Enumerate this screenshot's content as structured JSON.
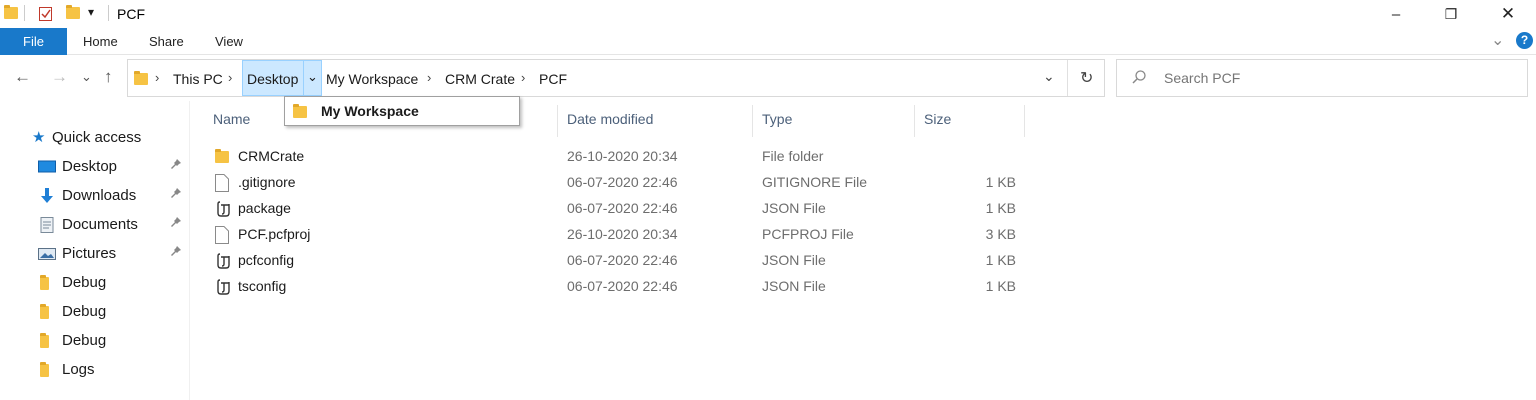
{
  "window": {
    "title": "PCF",
    "minimize_label": "–",
    "maximize_label": "❐",
    "close_label": "✕"
  },
  "quick_access_toolbar": {
    "dropdown_label": "▾"
  },
  "ribbon": {
    "tabs": [
      {
        "label": "File"
      },
      {
        "label": "Home"
      },
      {
        "label": "Share"
      },
      {
        "label": "View"
      }
    ],
    "expand_label": "⌄",
    "help_label": "?"
  },
  "address": {
    "crumbs": [
      "This PC",
      "Desktop",
      "My Workspace",
      "CRM Crate",
      "PCF"
    ],
    "separator": "›",
    "dropdown_chevron": "⌄",
    "history_chevron": "⌄",
    "refresh_label": "↻"
  },
  "crumb_dropdown": {
    "items": [
      {
        "label": "My Workspace"
      }
    ]
  },
  "search": {
    "placeholder": "Search PCF"
  },
  "nav_buttons": {
    "back": "←",
    "forward": "→",
    "recent": "⌄",
    "up": "↑"
  },
  "sidebar": {
    "quick_access_label": "Quick access",
    "items": [
      {
        "label": "Desktop",
        "icon": "desktop-icon",
        "pinned": true
      },
      {
        "label": "Downloads",
        "icon": "download-icon",
        "pinned": true
      },
      {
        "label": "Documents",
        "icon": "documents-icon",
        "pinned": true
      },
      {
        "label": "Pictures",
        "icon": "pictures-icon",
        "pinned": true
      },
      {
        "label": "Debug",
        "icon": "folder-icon",
        "pinned": false
      },
      {
        "label": "Debug",
        "icon": "folder-icon",
        "pinned": false
      },
      {
        "label": "Debug",
        "icon": "folder-icon",
        "pinned": false
      },
      {
        "label": "Logs",
        "icon": "folder-icon",
        "pinned": false
      }
    ],
    "pin_glyph": "📌"
  },
  "files": {
    "columns": [
      {
        "label": "Name"
      },
      {
        "label": "Date modified"
      },
      {
        "label": "Type"
      },
      {
        "label": "Size"
      }
    ],
    "rows": [
      {
        "name": "CRMCrate",
        "date": "26-10-2020 20:34",
        "type": "File folder",
        "size": "",
        "icon": "folder-icon"
      },
      {
        "name": ".gitignore",
        "date": "06-07-2020 22:46",
        "type": "GITIGNORE File",
        "size": "1 KB",
        "icon": "file-icon"
      },
      {
        "name": "package",
        "date": "06-07-2020 22:46",
        "type": "JSON File",
        "size": "1 KB",
        "icon": "json-file-icon"
      },
      {
        "name": "PCF.pcfproj",
        "date": "26-10-2020 20:34",
        "type": "PCFPROJ File",
        "size": "3 KB",
        "icon": "file-icon"
      },
      {
        "name": "pcfconfig",
        "date": "06-07-2020 22:46",
        "type": "JSON File",
        "size": "1 KB",
        "icon": "json-file-icon"
      },
      {
        "name": "tsconfig",
        "date": "06-07-2020 22:46",
        "type": "JSON File",
        "size": "1 KB",
        "icon": "json-file-icon"
      }
    ]
  },
  "colors": {
    "file_tab_bg": "#1979ca",
    "selection_bg": "#cce8ff",
    "folder_yellow": "#f6c344",
    "help_blue": "#1979ca"
  }
}
